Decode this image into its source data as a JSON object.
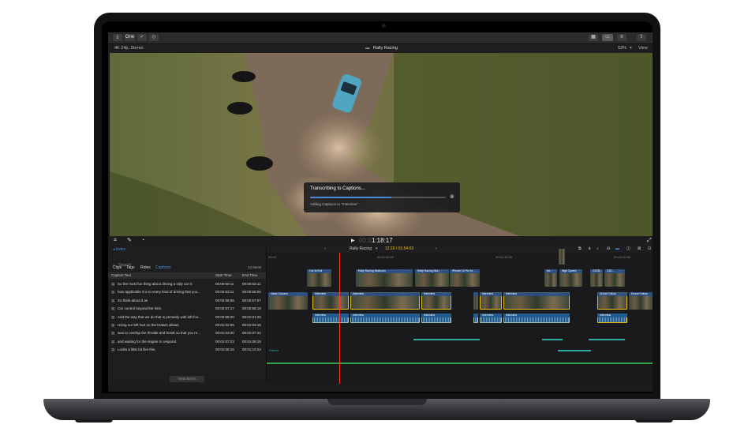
{
  "toolbar": {
    "left_buttons": [
      {
        "icon": "import-icon"
      },
      {
        "label": "One"
      },
      {
        "icon": "check-icon"
      },
      {
        "icon": "tag-icon"
      }
    ],
    "right_icons": [
      "grid-view-icon",
      "filmstrip-view-icon",
      "inspector-icon",
      "share-icon"
    ]
  },
  "infobar": {
    "format": "4K 24p, Stereo",
    "project_title": "Rally Racing",
    "zoom": "53%",
    "view_menu": "View"
  },
  "progress": {
    "title": "Transcribing to Captions...",
    "status": "Adding Captions to \"Interview\"",
    "fraction": 0.6
  },
  "viewer_controls": {
    "timecode": "1:18:17"
  },
  "browser": {
    "index_label": "Index",
    "search_placeholder": "Search",
    "tabs": [
      "Clips",
      "Tags",
      "Roles",
      "Captions"
    ],
    "active_tab": "Captions",
    "item_count": "24 Items",
    "columns": {
      "caption": "Caption Text",
      "start": "Start Time",
      "end": "End Time"
    },
    "rows": [
      {
        "text": "So the most fun thing about driving a rally car is",
        "start": "00:00:50:11",
        "end": "00:00:53:11"
      },
      {
        "text": "how applicable it is to every kind of driving that you...",
        "start": "00:00:53:11",
        "end": "00:00:56:06"
      },
      {
        "text": "So think about it as",
        "start": "00:00:56:06",
        "end": "00:00:57:07"
      },
      {
        "text": "Car control beyond the limit.",
        "start": "00:00:57:17",
        "end": "00:00:58:18"
      },
      {
        "text": "And the way that we do that is primarily with left foo...",
        "start": "00:00:58:20",
        "end": "00:01:01:20"
      },
      {
        "text": "Using our left foot on the brakes allows",
        "start": "00:01:02:06",
        "end": "00:01:03:18"
      },
      {
        "text": "was to overlap the throttle and break so that you re...",
        "start": "00:01:03:20",
        "end": "00:01:07:22"
      },
      {
        "text": "and waiting for the engine to respond.",
        "start": "00:01:07:23",
        "end": "00:01:09:15"
      },
      {
        "text": "Looks a little bit like this.",
        "start": "00:01:09:16",
        "end": "00:01:10:23"
      }
    ],
    "view_errors": "View Errors"
  },
  "timeline": {
    "project": "Rally Racing",
    "duration": "12:20 / 01:54:03",
    "ruler": [
      "00:00",
      "00:01:00:00",
      "00:01:30:00",
      "00:02:00:00"
    ],
    "connected_clips": [
      "Car B-Roll",
      "Rally Racing Multicam",
      "Rally Racing Mul...",
      "iPhone 16 Pro fo...",
      "Int...",
      "High Speed",
      "24OB...",
      "24O..."
    ],
    "primary_clips": [
      "Hand Camera",
      "Interview",
      "Interview",
      "Interview",
      "Interview",
      "Interview",
      "Interview",
      "Drone Follow"
    ],
    "audio_clips": [
      "Interview",
      "Interview",
      "Interview",
      "Interview",
      "Interview",
      "Interview"
    ],
    "track_label": "Effects"
  },
  "colors": {
    "accent": "#4a8bd8",
    "selected": "#e8c21b",
    "audio": "#1d4f7a",
    "playhead": "#ff3b30",
    "caption_lane": "#2fa8a0"
  }
}
